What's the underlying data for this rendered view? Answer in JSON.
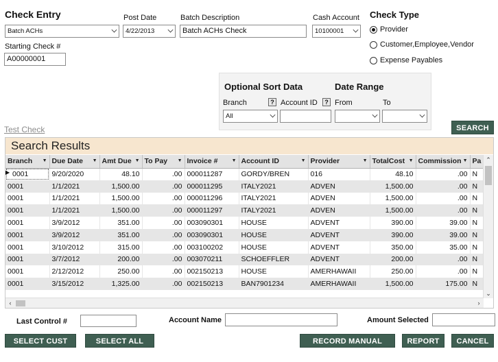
{
  "header": {
    "check_entry_title": "Check Entry",
    "check_entry_value": "Batch ACHs",
    "post_date_label": "Post Date",
    "post_date_value": "4/22/2013",
    "batch_description_label": "Batch Description",
    "batch_description_value": "Batch ACHs Check",
    "cash_account_label": "Cash Account",
    "cash_account_value": "10100001",
    "starting_check_label": "Starting Check #",
    "starting_check_value": "A00000001"
  },
  "check_type": {
    "title": "Check Type",
    "options": [
      {
        "label": "Provider",
        "selected": true
      },
      {
        "label": "Customer,Employee,Vendor",
        "selected": false
      },
      {
        "label": "Expense Payables",
        "selected": false
      }
    ]
  },
  "sort_panel": {
    "title": "Optional Sort Data",
    "date_range_title": "Date Range",
    "branch_label": "Branch",
    "branch_value": "All",
    "account_id_label": "Account ID",
    "account_id_value": "",
    "from_label": "From",
    "to_label": "To",
    "help_glyph": "?"
  },
  "test_check_link": "Test Check",
  "search_button": "SEARCH",
  "results": {
    "title": "Search Results",
    "columns": [
      "Branch",
      "Due Date",
      "Amt Due",
      "To Pay",
      "Invoice #",
      "Account ID",
      "Provider",
      "TotalCost",
      "Commission",
      "Pa"
    ],
    "rows": [
      [
        "0001",
        "9/20/2020",
        "48.10",
        ".00",
        "000011287",
        "GORDY/BREN",
        "016",
        "48.10",
        ".00",
        "N"
      ],
      [
        "0001",
        "1/1/2021",
        "1,500.00",
        ".00",
        "000011295",
        "ITALY2021",
        "ADVEN",
        "1,500.00",
        ".00",
        "N"
      ],
      [
        "0001",
        "1/1/2021",
        "1,500.00",
        ".00",
        "000011296",
        "ITALY2021",
        "ADVEN",
        "1,500.00",
        ".00",
        "N"
      ],
      [
        "0001",
        "1/1/2021",
        "1,500.00",
        ".00",
        "000011297",
        "ITALY2021",
        "ADVEN",
        "1,500.00",
        ".00",
        "N"
      ],
      [
        "0001",
        "3/9/2012",
        "351.00",
        ".00",
        "003090301",
        "HOUSE",
        "ADVENT",
        "390.00",
        "39.00",
        "N"
      ],
      [
        "0001",
        "3/9/2012",
        "351.00",
        ".00",
        "003090301",
        "HOUSE",
        "ADVENT",
        "390.00",
        "39.00",
        "N"
      ],
      [
        "0001",
        "3/10/2012",
        "315.00",
        ".00",
        "003100202",
        "HOUSE",
        "ADVENT",
        "350.00",
        "35.00",
        "N"
      ],
      [
        "0001",
        "3/7/2012",
        "200.00",
        ".00",
        "003070211",
        "SCHOEFFLER",
        "ADVENT",
        "200.00",
        ".00",
        "N"
      ],
      [
        "0001",
        "2/12/2012",
        "250.00",
        ".00",
        "002150213",
        "HOUSE",
        "AMERHAWAII",
        "250.00",
        ".00",
        "N"
      ],
      [
        "0001",
        "3/15/2012",
        "1,325.00",
        ".00",
        "002150213",
        "BAN7901234",
        "AMERHAWAII",
        "1,500.00",
        "175.00",
        "N"
      ]
    ]
  },
  "footer": {
    "last_control_label": "Last Control #",
    "account_name_label": "Account Name",
    "amount_selected_label": "Amount Selected",
    "buttons": {
      "select_cust_paid": "SELECT CUST PAID",
      "select_all": "SELECT ALL",
      "record_manual_check": "RECORD MANUAL CHECK",
      "report": "REPORT",
      "cancel": "CANCEL"
    }
  },
  "colors": {
    "button_bg": "#3f5f52",
    "results_header_bg": "#f7e6cf",
    "alt_row_bg": "#e6e6e6"
  }
}
